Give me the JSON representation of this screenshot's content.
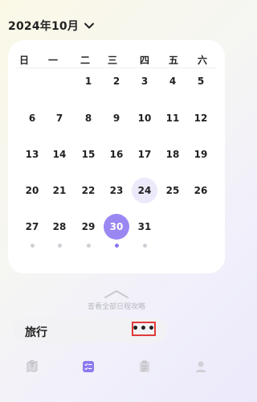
{
  "header": {
    "month_label": "2024年10月",
    "dropdown_icon": "chevron-down-icon"
  },
  "calendar": {
    "weekdays": [
      "日",
      "一",
      "二",
      "三",
      "四",
      "五",
      "六"
    ],
    "weeks": [
      [
        "",
        "",
        "1",
        "2",
        "3",
        "4",
        "5"
      ],
      [
        "6",
        "7",
        "8",
        "9",
        "10",
        "11",
        "12"
      ],
      [
        "13",
        "14",
        "15",
        "16",
        "17",
        "18",
        "19"
      ],
      [
        "20",
        "21",
        "22",
        "23",
        "24",
        "25",
        "26"
      ],
      [
        "27",
        "28",
        "29",
        "30",
        "31",
        "",
        ""
      ]
    ],
    "highlighted_day": "24",
    "selected_day": "30",
    "accent_color": "#9b87f2",
    "highlight_color": "#ece9fb"
  },
  "expand": {
    "icon": "chevron-up-icon",
    "label": "查看全部日程攻略"
  },
  "trip": {
    "title": "旅行",
    "more_label": "•••"
  },
  "tab_bar": {
    "items": [
      {
        "icon": "map-icon",
        "active": false
      },
      {
        "icon": "schedule-icon",
        "active": true
      },
      {
        "icon": "clipboard-icon",
        "active": false
      },
      {
        "icon": "profile-icon",
        "active": false
      }
    ],
    "active_color": "#8a79ee",
    "inactive_color": "#c4c4ca"
  }
}
